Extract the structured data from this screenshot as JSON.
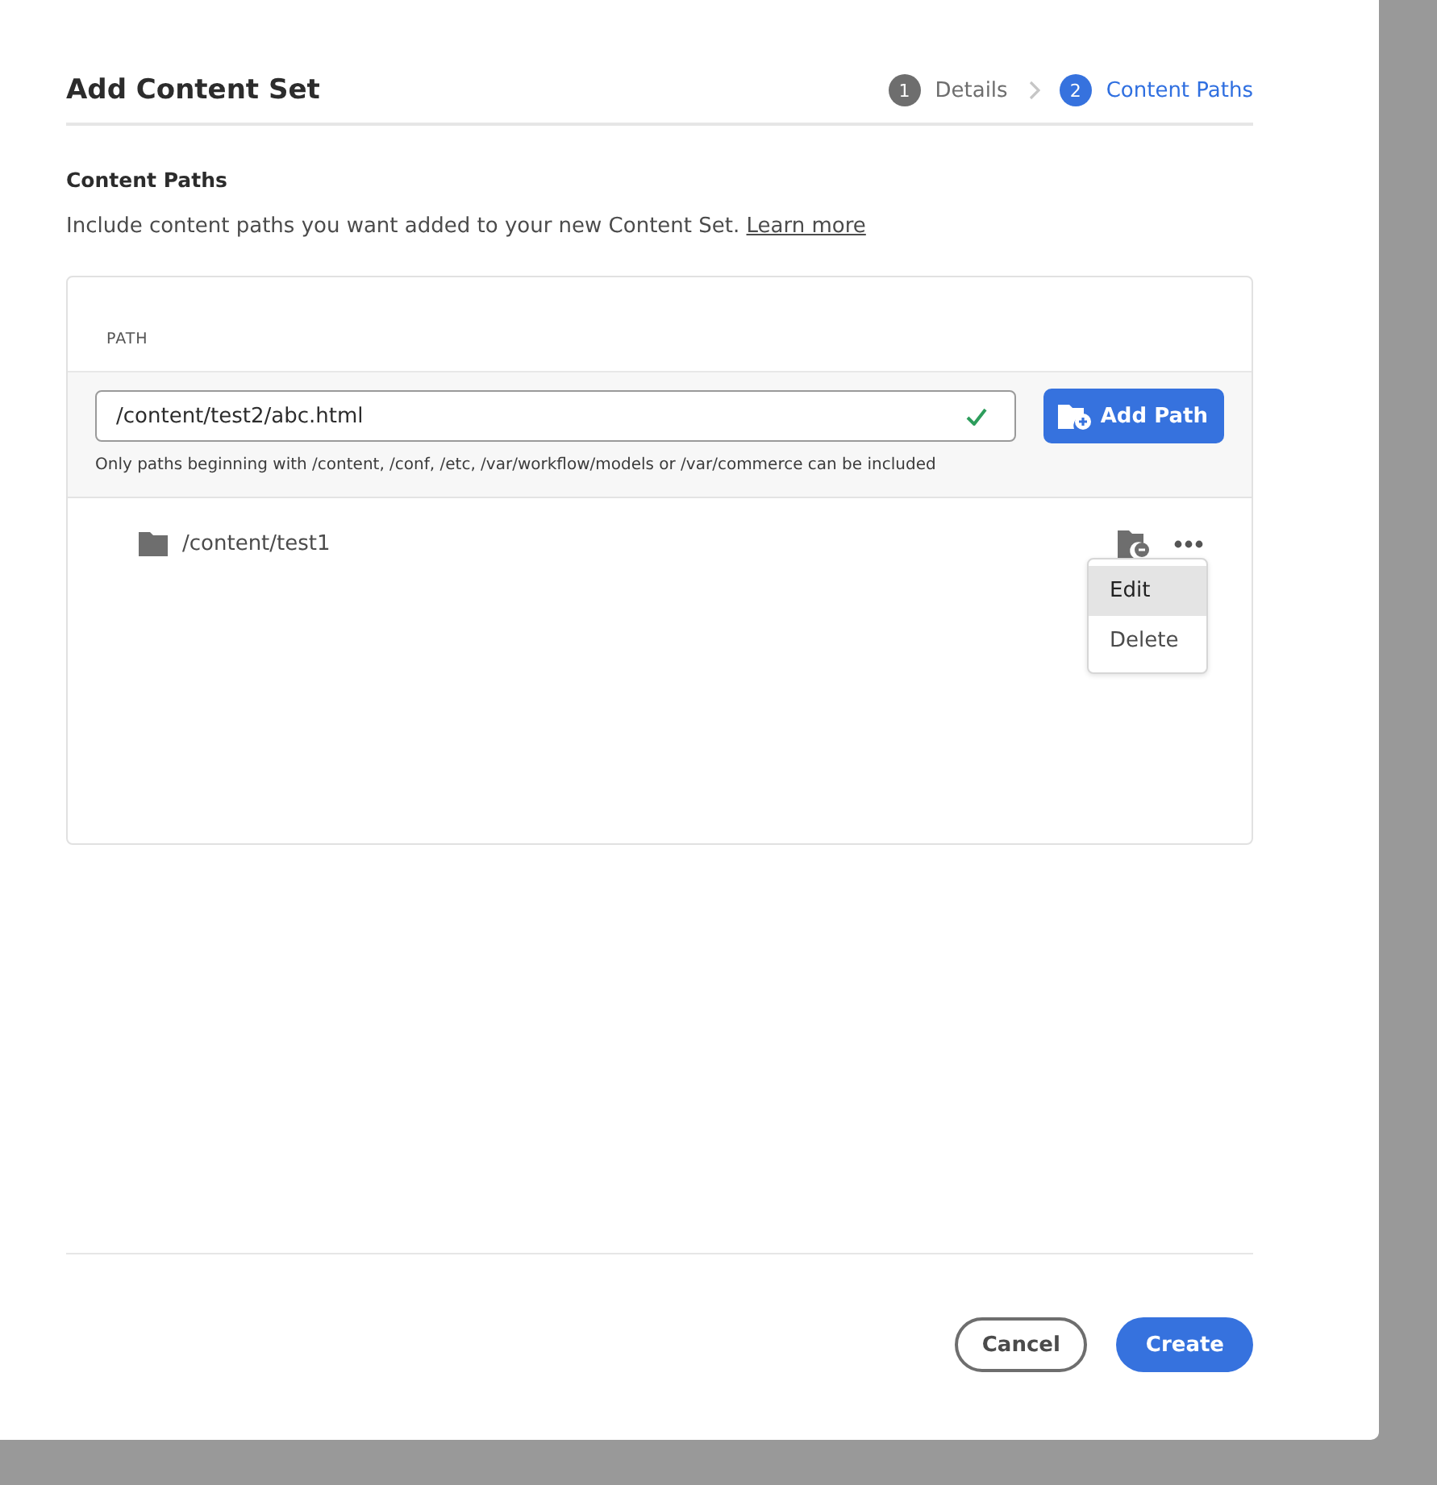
{
  "dialog": {
    "title": "Add Content Set"
  },
  "steps": [
    {
      "number": "1",
      "label": "Details",
      "selected": false
    },
    {
      "number": "2",
      "label": "Content Paths",
      "selected": true
    }
  ],
  "section": {
    "heading": "Content Paths",
    "description": "Include content paths you want added to your new Content Set.",
    "link": "Learn more"
  },
  "path_panel": {
    "column_header": "PATH",
    "input": {
      "value": "/content/test2/abc.html",
      "valid": true
    },
    "add_button": "Add Path",
    "help_text": "Only paths beginning with /content, /conf, /etc, /var/workflow/models or /var/commerce can be included"
  },
  "paths": [
    {
      "path": "/content/test1",
      "menu_open": true
    }
  ],
  "row_menu": [
    {
      "label": "Edit",
      "selected": true
    },
    {
      "label": "Delete",
      "selected": false
    }
  ],
  "buttons": {
    "cancel": "Cancel",
    "create": "Create"
  }
}
